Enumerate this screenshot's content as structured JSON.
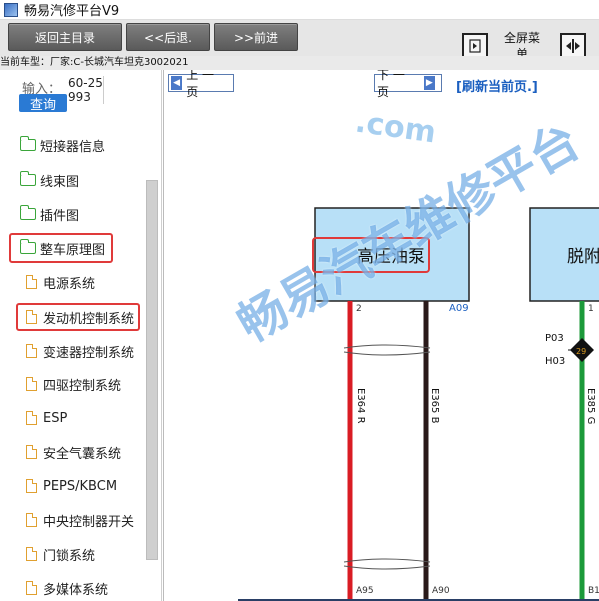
{
  "app": {
    "title": "畅易汽修平台V9"
  },
  "toolbar": {
    "home_label": "返回主目录",
    "back_label": "<<后退.",
    "forward_label": ">>前进",
    "fullscreen_label": "全屏菜单"
  },
  "vehicle": {
    "text": "当前车型：厂家:C-长城汽车坦克3002021"
  },
  "search": {
    "input_label": "输入：",
    "input_value": "60-25993",
    "query_label": "查询"
  },
  "tree": {
    "folders": [
      {
        "label": "短接器信息"
      },
      {
        "label": "线束图"
      },
      {
        "label": "插件图"
      },
      {
        "label": "整车原理图"
      }
    ],
    "docs": [
      {
        "label": "电源系统"
      },
      {
        "label": "发动机控制系统"
      },
      {
        "label": "变速器控制系统"
      },
      {
        "label": "四驱控制系统"
      },
      {
        "label": "ESP"
      },
      {
        "label": "安全气囊系统"
      },
      {
        "label": "PEPS/KBCM"
      },
      {
        "label": "中央控制器开关"
      },
      {
        "label": "门锁系统"
      },
      {
        "label": "多媒体系统"
      }
    ]
  },
  "viewer": {
    "prev_label": "上 一 页",
    "next_label": "下 一 页",
    "refresh_label": "[刷新当前页.]"
  },
  "diagram": {
    "component1": "高压油泵",
    "component2": "脱附",
    "pins": {
      "p1_top": "2",
      "p1_conn": "A09",
      "p2_top": "1",
      "p1_bottom": "A95",
      "p2_bottom": "A90",
      "p3_bottom": "B1"
    },
    "wires": [
      {
        "label": "E364 R",
        "color": "#d91c24"
      },
      {
        "label": "E365 B",
        "color": "#2a1a1a"
      },
      {
        "label": "E385 G",
        "color": "#1c9a3a"
      }
    ],
    "splice": {
      "left_top": "P03",
      "left_bottom": "H03",
      "id": "29"
    }
  },
  "watermark": {
    "main": "畅易汽车维修平台",
    "url": ".com"
  }
}
